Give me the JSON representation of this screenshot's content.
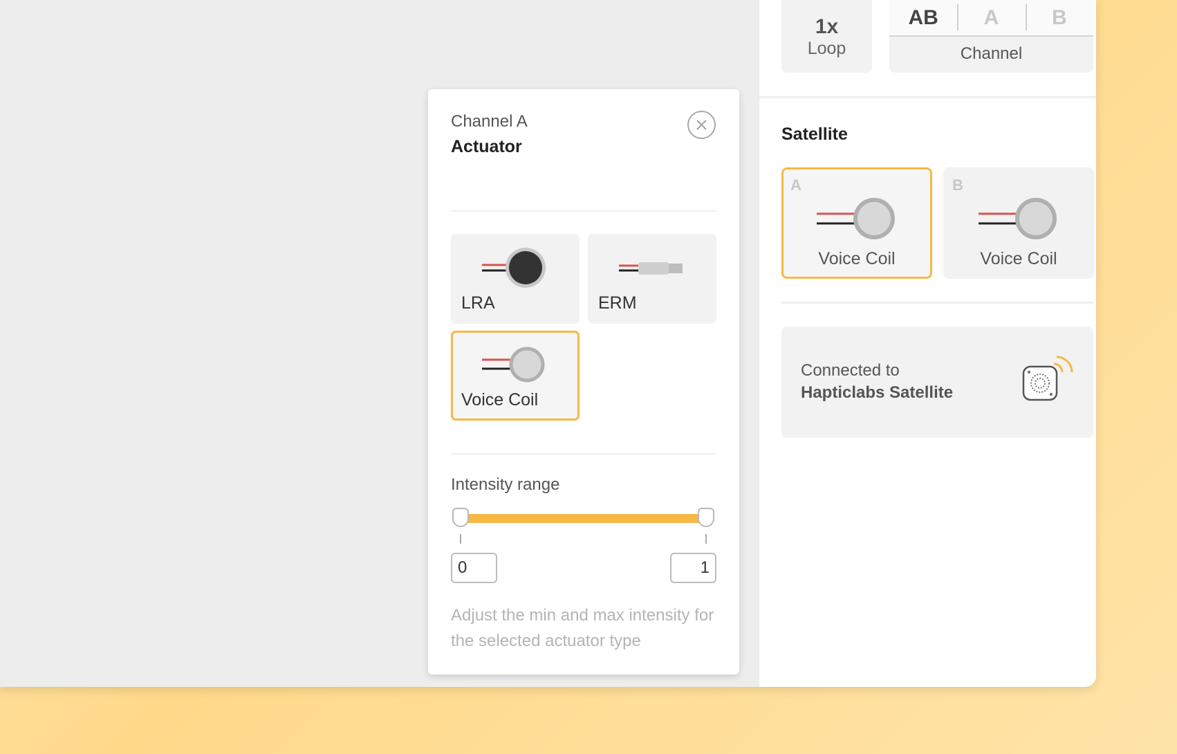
{
  "top": {
    "loop_count": "1x",
    "loop_label": "Loop",
    "channel_tabs": [
      "AB",
      "A",
      "B"
    ],
    "channel_active": "AB",
    "channel_label": "Channel"
  },
  "satellite": {
    "title": "Satellite",
    "slots": [
      {
        "letter": "A",
        "label": "Voice Coil",
        "selected": true
      },
      {
        "letter": "B",
        "label": "Voice Coil",
        "selected": false
      }
    ]
  },
  "connection": {
    "line1": "Connected to",
    "line2": "Hapticlabs Satellite",
    "icon": "satellite-device-signal-icon"
  },
  "actuator_popover": {
    "channel": "Channel A",
    "title": "Actuator",
    "options": [
      {
        "label": "LRA",
        "icon": "lra-icon",
        "selected": false
      },
      {
        "label": "ERM",
        "icon": "erm-icon",
        "selected": false
      },
      {
        "label": "Voice Coil",
        "icon": "voice-coil-icon",
        "selected": true
      }
    ],
    "intensity_label": "Intensity range",
    "min_value": "0",
    "max_value": "1",
    "range_fraction": [
      0,
      1
    ],
    "help_text": "Adjust the min and max intensity for the selected actuator type"
  },
  "colors": {
    "accent": "#f7b845",
    "background_gradient": [
      "#fde9c0",
      "#ffd98a"
    ]
  }
}
